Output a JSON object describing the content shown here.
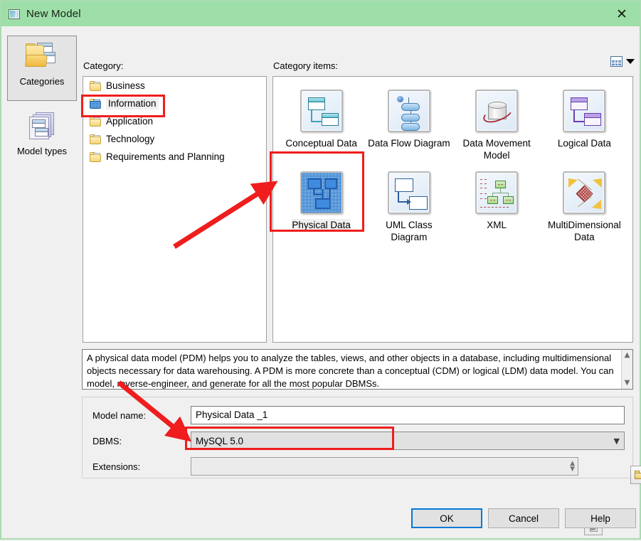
{
  "window": {
    "title": "New Model",
    "title_icon": "model-window-icon",
    "close_icon": "close-icon",
    "titlebar_color": "#9edfa9",
    "accent_color": "#0078d7",
    "annotation_color": "#ef1d1d"
  },
  "rail": {
    "items": [
      {
        "label": "Categories",
        "icon": "categories-folder-icon",
        "selected": true
      },
      {
        "label": "Model types",
        "icon": "model-types-stack-icon",
        "selected": false
      }
    ]
  },
  "category": {
    "label": "Category:",
    "items": [
      {
        "label": "Business",
        "icon": "folder-icon",
        "selected": false
      },
      {
        "label": "Information",
        "icon": "folder-dotted-icon",
        "selected": true
      },
      {
        "label": "Application",
        "icon": "folder-icon",
        "selected": false
      },
      {
        "label": "Technology",
        "icon": "folder-icon",
        "selected": false
      },
      {
        "label": "Requirements and Planning",
        "icon": "folder-icon",
        "selected": false
      }
    ]
  },
  "category_items": {
    "label": "Category items:",
    "view_toggle_icon": "grid-view-icon",
    "view_toggle_caret": "chevron-down-icon",
    "items": [
      {
        "label": "Conceptual Data",
        "icon": "conceptual-data-icon",
        "selected": false
      },
      {
        "label": "Data Flow Diagram",
        "icon": "data-flow-diagram-icon",
        "selected": false
      },
      {
        "label": "Data Movement Model",
        "icon": "data-movement-model-icon",
        "selected": false
      },
      {
        "label": "Logical Data",
        "icon": "logical-data-icon",
        "selected": false
      },
      {
        "label": "Physical Data",
        "icon": "physical-data-icon",
        "selected": true
      },
      {
        "label": "UML Class Diagram",
        "icon": "uml-class-diagram-icon",
        "selected": false
      },
      {
        "label": "XML",
        "icon": "xml-icon",
        "selected": false
      },
      {
        "label": "MultiDimensional Data",
        "icon": "multidimensional-data-icon",
        "selected": false
      }
    ]
  },
  "description": {
    "text": "A physical data model (PDM) helps you to analyze the tables, views, and other objects in a database, including multidimensional objects necessary for data warehousing. A PDM is more concrete than a conceptual (CDM) or logical (LDM) data model. You can model, reverse-engineer, and generate for all the most popular DBMSs.",
    "scroll_up_icon": "scroll-up-icon",
    "scroll_down_icon": "scroll-down-icon"
  },
  "form": {
    "model_name_label": "Model name:",
    "model_name_value": "Physical Data _1",
    "model_name_placeholder": "",
    "dbms_label": "DBMS:",
    "dbms_value": "MySQL 5.0",
    "dbms_caret": "chevron-down-icon",
    "dbms_browse_icon": "folder-open-icon",
    "dbms_new_icon": "new-document-icon",
    "extensions_label": "Extensions:",
    "extensions_value": "",
    "extensions_placeholder": "",
    "extensions_spinner_up": "spinner-up-icon",
    "extensions_spinner_down": "spinner-down-icon",
    "extensions_browse_icon": "extension-document-icon"
  },
  "buttons": {
    "ok": "OK",
    "cancel": "Cancel",
    "help": "Help"
  },
  "annotations": {
    "arrow_to_physical_data": "red-arrow-up-right",
    "arrow_to_dbms": "red-arrow-down-right",
    "box_information": "red-box-information",
    "box_physical_data": "red-box-physical-data",
    "box_dbms": "red-box-dbms"
  }
}
